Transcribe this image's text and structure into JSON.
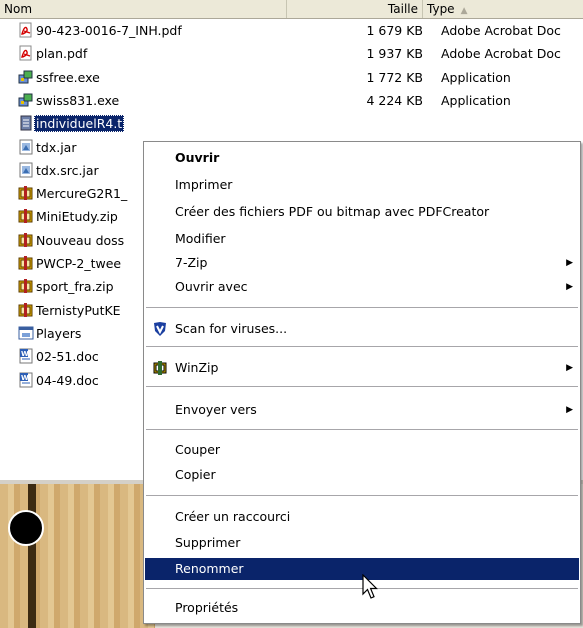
{
  "header": {
    "name": "Nom",
    "size": "Taille",
    "type": "Type"
  },
  "files": [
    {
      "name": "90-423-0016-7_INH.pdf",
      "size": "1 679 KB",
      "type": "Adobe Acrobat Doc",
      "icon": "pdf-icon"
    },
    {
      "name": "plan.pdf",
      "size": "1 937 KB",
      "type": "Adobe Acrobat Doc",
      "icon": "pdf-icon"
    },
    {
      "name": "ssfree.exe",
      "size": "1 772 KB",
      "type": "Application",
      "icon": "installer-icon"
    },
    {
      "name": "swiss831.exe",
      "size": "4 224 KB",
      "type": "Application",
      "icon": "installer-icon"
    },
    {
      "name": "individuelR4.t",
      "size": "",
      "type": "",
      "icon": "text-file-icon"
    },
    {
      "name": "tdx.jar",
      "size": "",
      "type": "",
      "icon": "jar-icon"
    },
    {
      "name": "tdx.src.jar",
      "size": "",
      "type": "",
      "icon": "jar-icon"
    },
    {
      "name": "MercureG2R1_",
      "size": "",
      "type": "",
      "icon": "zip-icon"
    },
    {
      "name": "MiniEtudy.zip",
      "size": "",
      "type": "",
      "icon": "zip-icon"
    },
    {
      "name": "Nouveau doss",
      "size": "",
      "type": "",
      "icon": "zip-icon"
    },
    {
      "name": "PWCP-2_twee",
      "size": "",
      "type": "",
      "icon": "zip-icon"
    },
    {
      "name": "sport_fra.zip",
      "size": "",
      "type": "",
      "icon": "zip-icon"
    },
    {
      "name": "TernistyPutKE",
      "size": "",
      "type": "",
      "icon": "zip-icon"
    },
    {
      "name": "Players",
      "size": "",
      "type": "",
      "icon": "window-icon"
    },
    {
      "name": "02-51.doc",
      "size": "",
      "type": "",
      "icon": "word-doc-icon"
    },
    {
      "name": "04-49.doc",
      "size": "",
      "type": "",
      "icon": "word-doc-icon"
    }
  ],
  "menu": {
    "open": "Ouvrir",
    "print": "Imprimer",
    "pdfcreator": "Créer des fichiers PDF ou bitmap avec PDFCreator",
    "edit": "Modifier",
    "sevenzip": "7-Zip",
    "open_with": "Ouvrir avec",
    "scan": "Scan for viruses...",
    "winzip": "WinZip",
    "send_to": "Envoyer vers",
    "cut": "Couper",
    "copy": "Copier",
    "create_shortcut": "Créer un raccourci",
    "delete": "Supprimer",
    "rename": "Renommer",
    "properties": "Propriétés"
  },
  "colors": {
    "selection": "#0a246a",
    "menu_bg": "#ffffff",
    "header_bg": "#ece9d8"
  }
}
